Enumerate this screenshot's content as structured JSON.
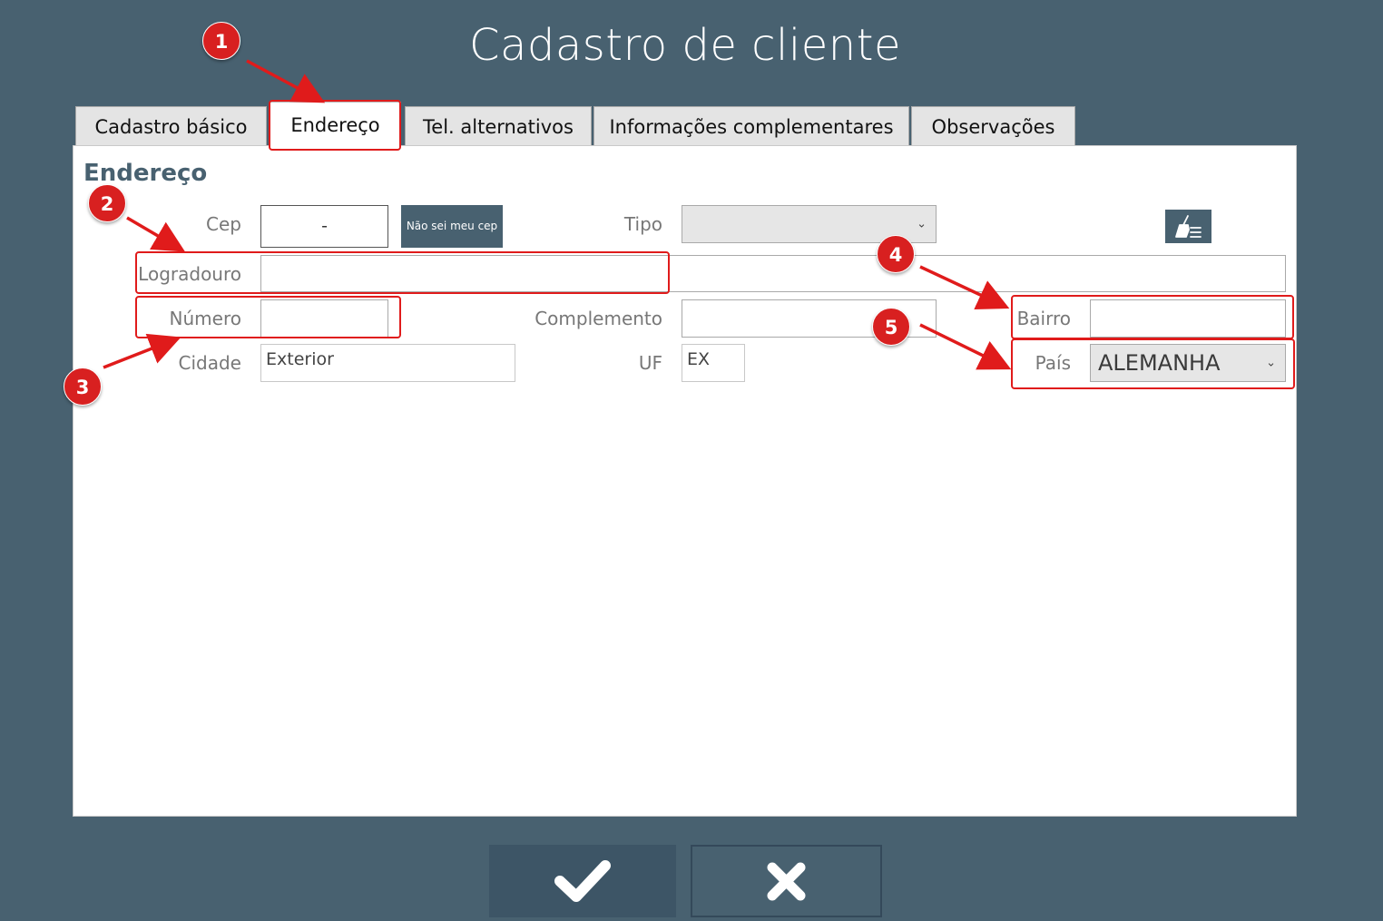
{
  "window": {
    "title": "Cadastro de cliente"
  },
  "tabs": [
    {
      "label": "Cadastro básico"
    },
    {
      "label": "Endereço"
    },
    {
      "label": "Tel. alternativos"
    },
    {
      "label": "Informações complementares"
    },
    {
      "label": "Observações"
    }
  ],
  "active_tab": "Endereço",
  "section": {
    "title": "Endereço"
  },
  "form": {
    "cep": {
      "label": "Cep",
      "value": "-"
    },
    "nao_sei_cep": {
      "label": "Não sei meu cep"
    },
    "tipo": {
      "label": "Tipo",
      "value": ""
    },
    "logradouro": {
      "label": "Logradouro",
      "value": ""
    },
    "numero": {
      "label": "Número",
      "value": ""
    },
    "complemento": {
      "label": "Complemento",
      "value": ""
    },
    "bairro": {
      "label": "Bairro",
      "value": ""
    },
    "cidade": {
      "label": "Cidade",
      "value": "Exterior"
    },
    "uf": {
      "label": "UF",
      "value": "EX"
    },
    "pais": {
      "label": "País",
      "value": "ALEMANHA"
    }
  },
  "annotations": [
    "1",
    "2",
    "3",
    "4",
    "5"
  ],
  "icons": {
    "clear": "broom-list-icon",
    "confirm": "checkmark-icon",
    "cancel": "close-icon",
    "dropdown": "chevron-down-icon"
  },
  "colors": {
    "background": "#486170",
    "accent": "#486170",
    "annotation": "#d82020"
  }
}
